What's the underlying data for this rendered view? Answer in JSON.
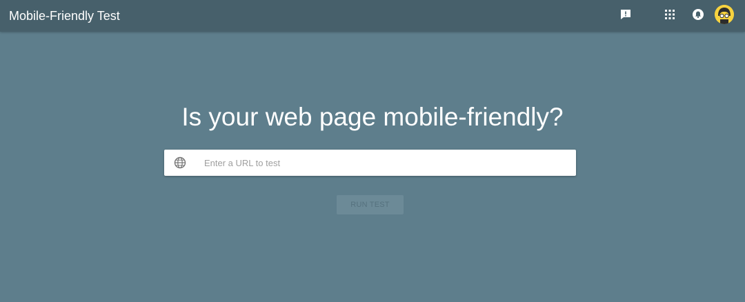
{
  "app": {
    "title": "Mobile-Friendly Test"
  },
  "toolbar": {
    "icons": [
      "feedback-icon",
      "apps-icon",
      "notifications-icon",
      "account-avatar"
    ]
  },
  "main": {
    "headline": "Is your web page mobile-friendly?",
    "url_input": {
      "value": "",
      "placeholder": "Enter a URL to test",
      "icon": "globe-icon"
    },
    "run_button": {
      "label": "RUN TEST",
      "enabled": false
    }
  },
  "colors": {
    "appbar": "#47606b",
    "background": "#5e7e8c",
    "input_background": "#ffffff",
    "button_disabled": "#6c8a97",
    "avatar": "#f6d23f"
  }
}
